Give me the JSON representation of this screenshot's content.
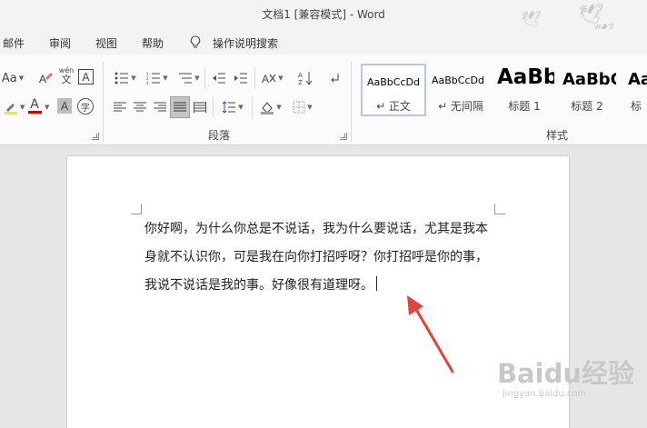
{
  "title_bar": {
    "title": "文档1 [兼容模式]  -  Word"
  },
  "tabs": [
    {
      "label": "邮件"
    },
    {
      "label": "审阅"
    },
    {
      "label": "视图"
    },
    {
      "label": "帮助"
    },
    {
      "label": "操作说明搜索"
    }
  ],
  "ribbon": {
    "font_group": {
      "font_size_label": "Aa",
      "phonetic_label": "wén",
      "phonetic_char": "文",
      "border_char": "A",
      "font_color_char": "A",
      "shading_char": "A",
      "enclose_char": "字",
      "highlight_color": "#f5e627",
      "font_color": "#d00000"
    },
    "paragraph_group": {
      "label": "段落"
    },
    "styles_group": {
      "label": "样式",
      "items": [
        {
          "sample": "AaBbCcDd",
          "name": "↵ 正文"
        },
        {
          "sample": "AaBbCcDd",
          "name": "↵ 无间隔"
        },
        {
          "sample": "AaBb",
          "name": "标题 1"
        },
        {
          "sample": "AaBbC",
          "name": "标题 2"
        },
        {
          "sample": "Aa",
          "name": "标"
        }
      ]
    }
  },
  "document": {
    "text": "你好啊，为什么你总是不说话，我为什么要说话，尤其是我本身就不认识你，可是我在向你打招呼呀？你打招呼是你的事，我说不说话是我的事。好像很有道理呀。"
  },
  "watermark": {
    "logo": "Baidu经验",
    "sub": "jingyan.baidu.com"
  },
  "colors": {
    "arrow": "#e0453b",
    "accent": "#2b579a"
  }
}
